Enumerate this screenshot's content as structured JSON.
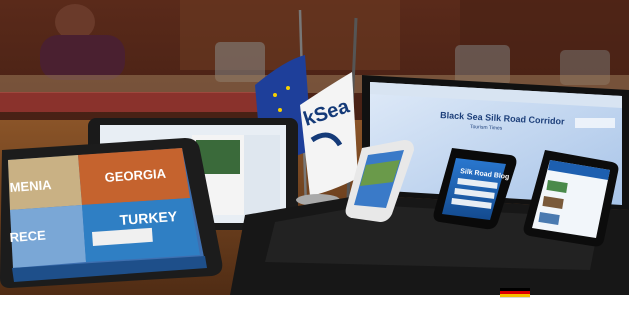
{
  "tablet_left": {
    "tiles": [
      "MENIA",
      "GEORGIA",
      "RECE",
      "TURKEY"
    ]
  },
  "flag_logo": {
    "text": "kSea"
  },
  "laptop": {
    "site_title": "Black Sea Silk Road Corridor",
    "site_subtitle": "Tourism Times"
  },
  "phone_middle": {
    "app_title": "Silk Road Blog"
  },
  "colors": {
    "wood_table": "#6b3f1c",
    "wall": "#3a1a12",
    "app_blue": "#1d5fb0",
    "flag_white": "#f4f4f4",
    "logo_navy": "#143a78"
  }
}
